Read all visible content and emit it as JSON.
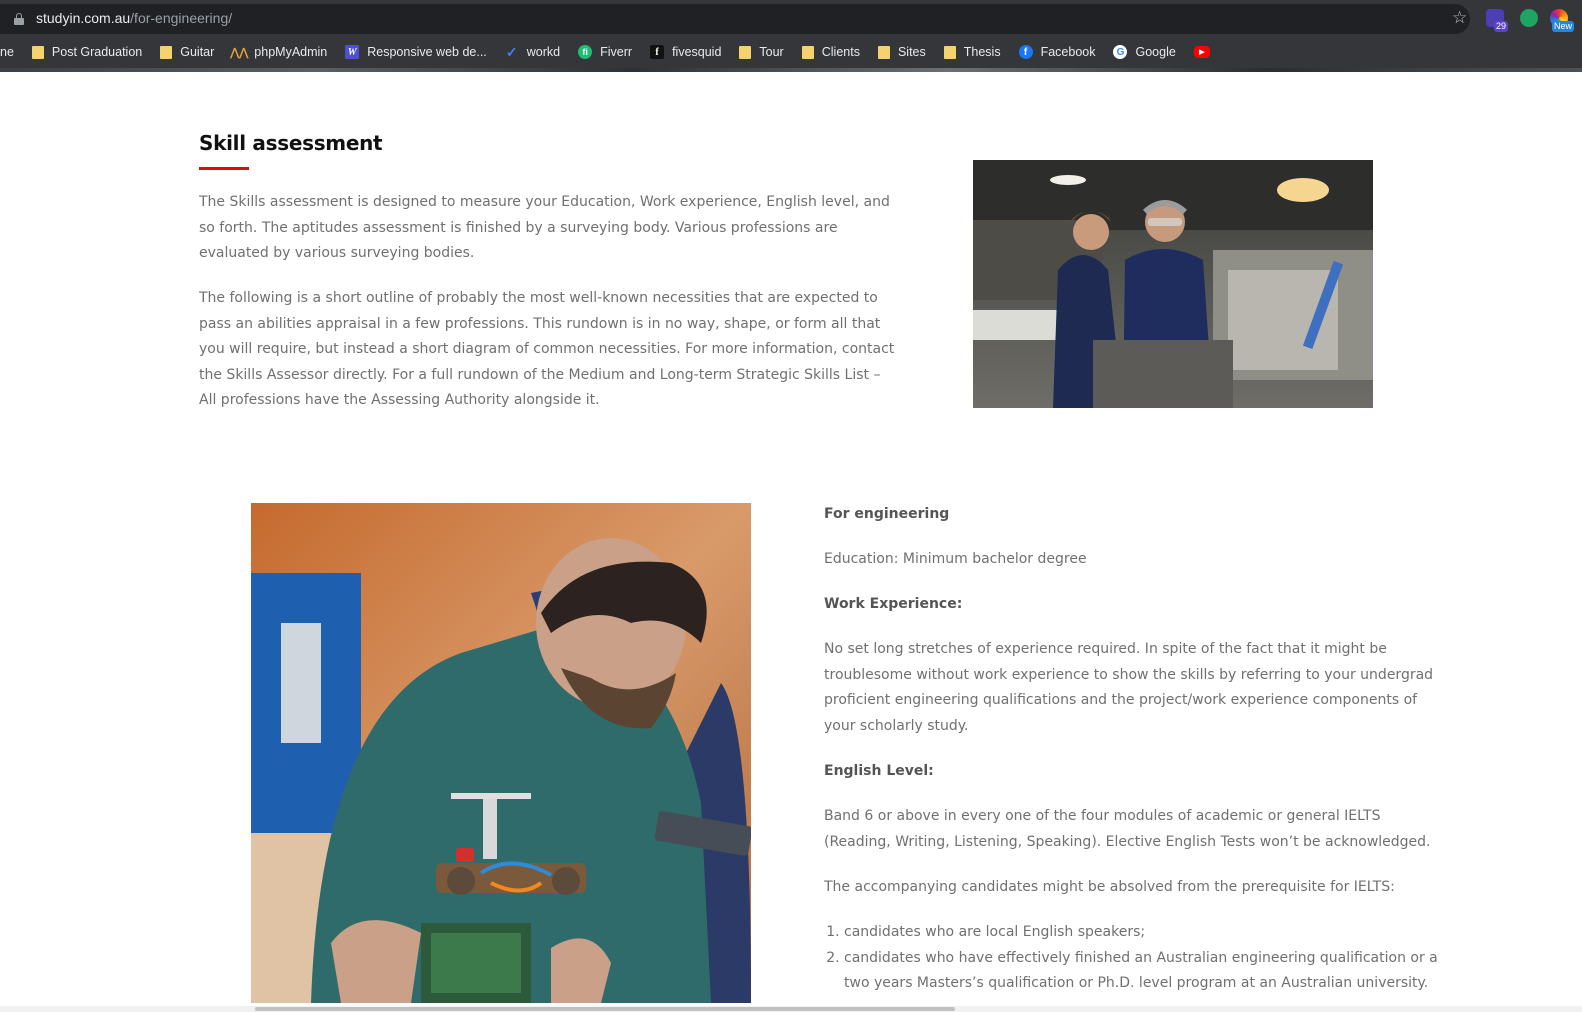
{
  "browser": {
    "url_host": "studyin.com.au",
    "url_path": "/for-engineering/",
    "extension_badge_count": "29",
    "extension_new_label": "New",
    "bookmarks": [
      {
        "label": "ne",
        "icon": "folder-icon"
      },
      {
        "label": "Post Graduation",
        "icon": "folder-icon"
      },
      {
        "label": "Guitar",
        "icon": "folder-icon"
      },
      {
        "label": "phpMyAdmin",
        "icon": "phpmyadmin-icon"
      },
      {
        "label": "Responsive web de...",
        "icon": "w-icon"
      },
      {
        "label": "workd",
        "icon": "workd-icon"
      },
      {
        "label": "Fiverr",
        "icon": "fiverr-icon"
      },
      {
        "label": "fivesquid",
        "icon": "fivesquid-icon"
      },
      {
        "label": "Tour",
        "icon": "folder-icon"
      },
      {
        "label": "Clients",
        "icon": "folder-icon"
      },
      {
        "label": "Sites",
        "icon": "folder-icon"
      },
      {
        "label": "Thesis",
        "icon": "folder-icon"
      },
      {
        "label": "Facebook",
        "icon": "facebook-icon"
      },
      {
        "label": "Google",
        "icon": "google-icon"
      },
      {
        "label": "",
        "icon": "youtube-icon"
      }
    ]
  },
  "page": {
    "heading": "Skill assessment",
    "accent_color": "#e30613",
    "intro_paragraph": "The Skills assessment is designed to measure your Education, Work experience, English level, and so forth. The aptitudes assessment is finished by a surveying body. Various professions are evaluated by various surveying bodies.",
    "outline_paragraph": "The following is a short outline of probably the most well-known necessities that are expected to pass an abilities appraisal in a few professions. This rundown is in no way, shape, or form all that you will require, but instead a short diagram of common necessities. For more information, contact the Skills Assessor directly. For a full rundown of the Medium and Long-term Strategic Skills List – All professions have the Assessing Authority alongside it.",
    "engineering": {
      "title": "For engineering",
      "education": "Education: Minimum bachelor degree",
      "work_experience_label": "Work Experience:",
      "work_experience_text": "No set long stretches of experience required. In spite of the fact that it might be troublesome without work experience to show the skills by referring to your undergrad proficient engineering qualifications and the project/work experience components of your scholarly study.",
      "english_label": "English Level:",
      "english_text": "Band 6 or above in every one of the four modules of academic or general IELTS (Reading, Writing, Listening, Speaking). Elective English Tests won’t be acknowledged.",
      "exemption_intro": "The accompanying candidates might be absolved from the prerequisite for IELTS:",
      "exemptions": [
        "candidates who are local English speakers;",
        "candidates who have effectively finished an Australian engineering qualification or a two years Masters’s qualification or Ph.D. level program at an Australian university."
      ]
    }
  }
}
